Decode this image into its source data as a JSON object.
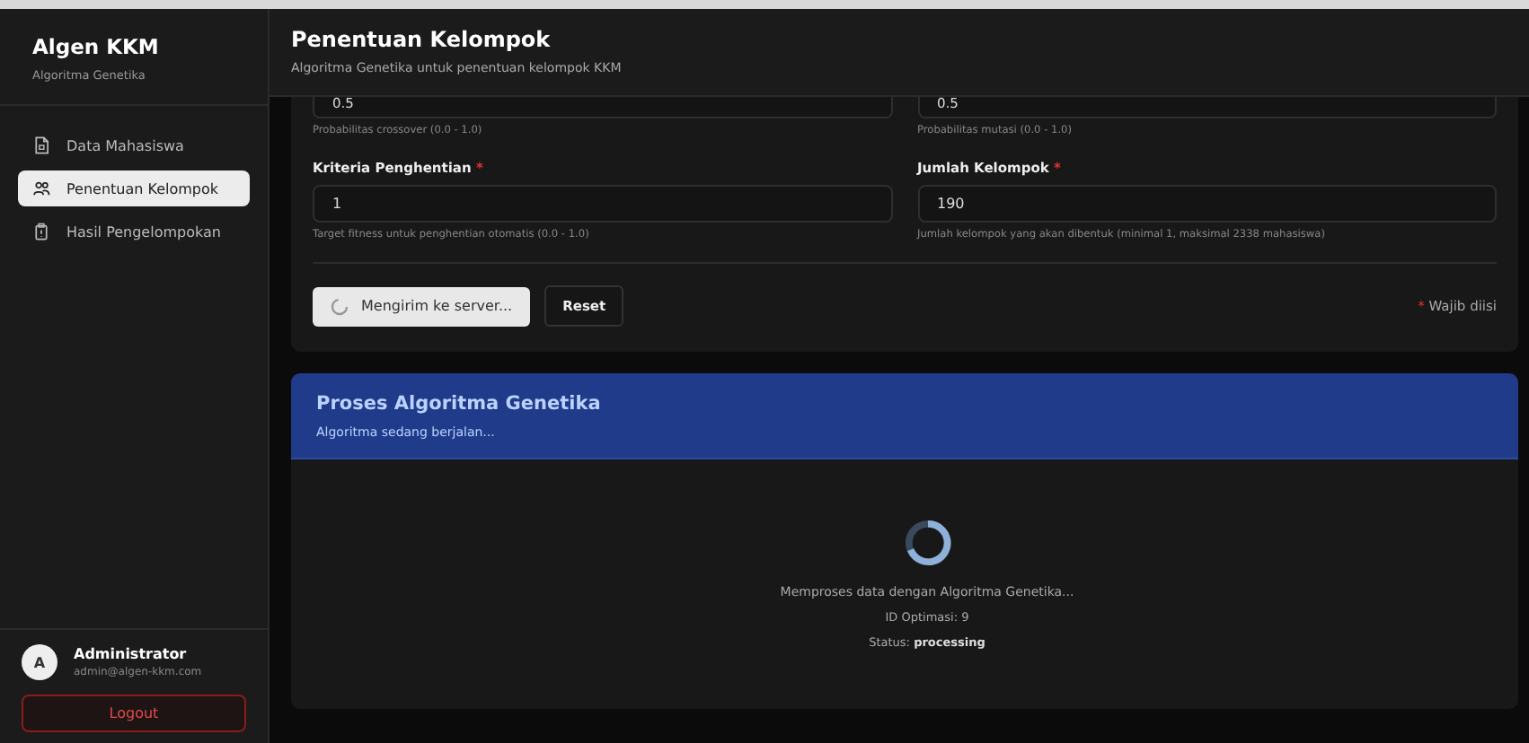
{
  "sidebar": {
    "app_title": "Algen KKM",
    "app_subtitle": "Algoritma Genetika",
    "items": [
      {
        "label": "Data Mahasiswa",
        "selected": false
      },
      {
        "label": "Penentuan Kelompok",
        "selected": true
      },
      {
        "label": "Hasil Pengelompokan",
        "selected": false
      }
    ],
    "user": {
      "avatar": "A",
      "name": "Administrator",
      "email": "admin@algen-kkm.com"
    },
    "logout": "Logout"
  },
  "header": {
    "title": "Penentuan Kelompok",
    "subtitle": "Algoritma Genetika untuk penentuan kelompok KKM"
  },
  "form": {
    "partial_fields": [
      {
        "value": "0.5",
        "hint": "Probabilitas crossover (0.0 - 1.0)"
      },
      {
        "value": "0.5",
        "hint": "Probabilitas mutasi (0.0 - 1.0)"
      }
    ],
    "fields": [
      {
        "label": "Kriteria Penghentian",
        "required_mark": "*",
        "value": "1",
        "hint": "Target fitness untuk penghentian otomatis (0.0 - 1.0)"
      },
      {
        "label": "Jumlah Kelompok",
        "required_mark": "*",
        "value": "190",
        "hint": "Jumlah kelompok yang akan dibentuk (minimal 1, maksimal 2338 mahasiswa)"
      }
    ],
    "submit": {
      "label": "Mengirim ke server...",
      "busy": true
    },
    "reset": "Reset",
    "legend": {
      "required_mark": "*",
      "text": "Wajib diisi"
    }
  },
  "process": {
    "title": "Proses Algoritma Genetika",
    "subtitle": "Algoritma sedang berjalan...",
    "message": "Memproses data dengan Algoritma Genetika...",
    "id_line": "ID Optimasi: 9",
    "status_label": "Status:",
    "status_value": "processing"
  }
}
